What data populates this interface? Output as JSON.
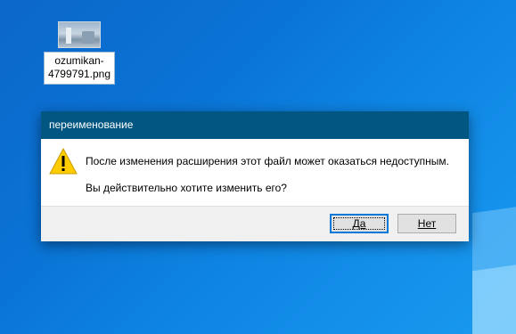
{
  "desktop": {
    "icon": {
      "name": "image-file-icon",
      "label": "ozumikan-4799791.png"
    }
  },
  "dialog": {
    "title": "переименование",
    "message_primary": "После изменения расширения этот файл может оказаться недоступным.",
    "message_secondary": "Вы действительно хотите изменить его?",
    "icon": "warning-icon",
    "buttons": {
      "yes_label": "Да",
      "no_label": "Нет"
    },
    "colors": {
      "titlebar": "#025782",
      "accent": "#0078d7",
      "warning": "#ffcc00"
    }
  }
}
